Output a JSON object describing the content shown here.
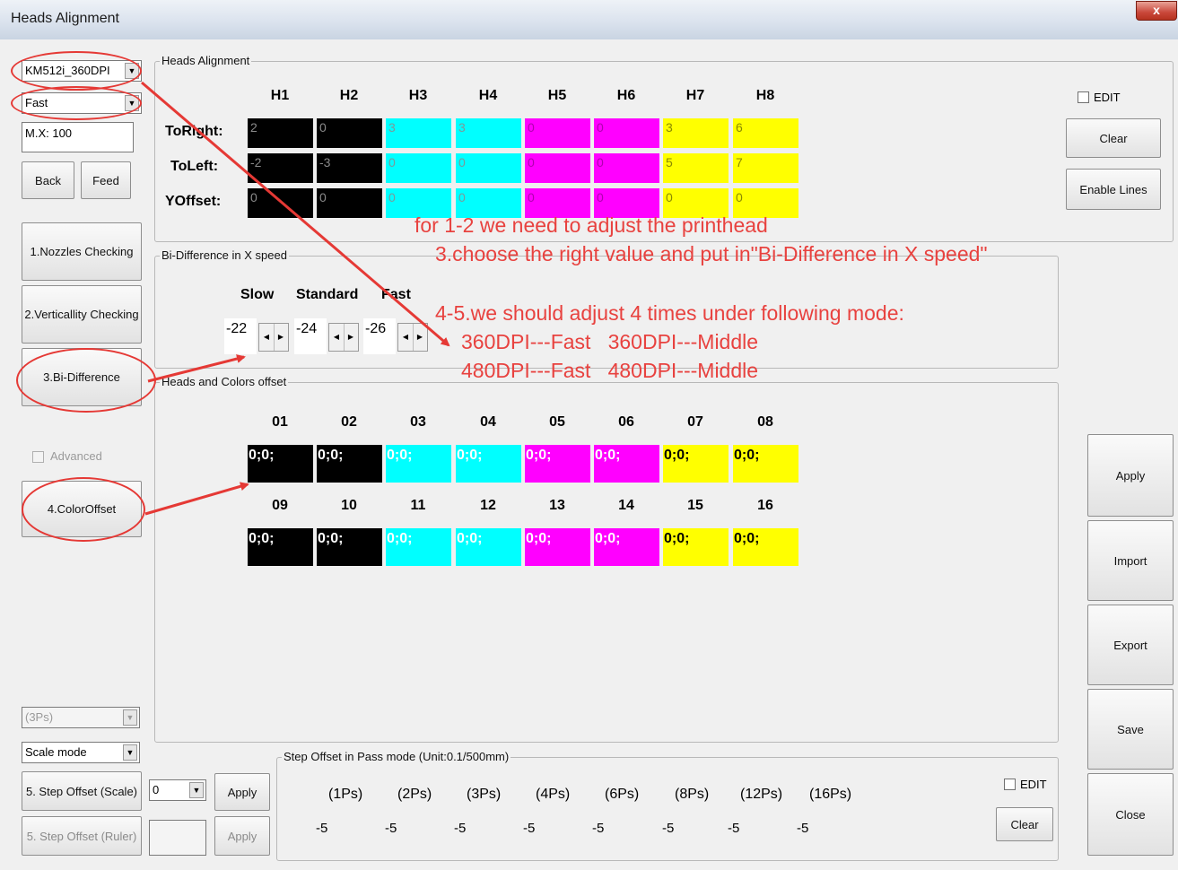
{
  "window": {
    "title": "Heads Alignment",
    "close_label": "x"
  },
  "left": {
    "head_select": "KM512i_360DPI",
    "speed_select": "Fast",
    "mx_value": "M.X: 100",
    "back": "Back",
    "feed": "Feed",
    "nozzles": "1.Nozzles Checking",
    "verticality": "2.Verticallity Checking",
    "bidiff": "3.Bi-Difference",
    "advanced": "Advanced",
    "coloroffset": "4.ColorOffset",
    "pass_select": "(3Ps)",
    "mode_select": "Scale mode",
    "step_scale": "5. Step Offset (Scale)",
    "step_scale_value": "0",
    "apply1": "Apply",
    "step_ruler": "5. Step Offset (Ruler)",
    "apply2": "Apply"
  },
  "heads_alignment": {
    "label": "Heads Alignment",
    "headers": [
      "H1",
      "H2",
      "H3",
      "H4",
      "H5",
      "H6",
      "H7",
      "H8"
    ],
    "colors": [
      "k",
      "k",
      "c",
      "c",
      "m",
      "m",
      "y",
      "y"
    ],
    "rows": [
      {
        "label": "ToRight:",
        "values": [
          "2",
          "0",
          "3",
          "3",
          "0",
          "0",
          "3",
          "6"
        ]
      },
      {
        "label": "ToLeft:",
        "values": [
          "-2",
          "-3",
          "0",
          "0",
          "0",
          "0",
          "5",
          "7"
        ]
      },
      {
        "label": "YOffset:",
        "values": [
          "0",
          "0",
          "0",
          "0",
          "0",
          "0",
          "0",
          "0"
        ]
      }
    ]
  },
  "bi_difference": {
    "label": "Bi-Difference in X speed",
    "slow": "Slow",
    "standard": "Standard",
    "fast": "Fast",
    "slow_value": "-22",
    "standard_value": "-24",
    "fast_value": "-26"
  },
  "colors_offset": {
    "label": "Heads and Colors offset",
    "headers1": [
      "01",
      "02",
      "03",
      "04",
      "05",
      "06",
      "07",
      "08"
    ],
    "headers2": [
      "09",
      "10",
      "11",
      "12",
      "13",
      "14",
      "15",
      "16"
    ],
    "colors": [
      "k",
      "k",
      "c",
      "c",
      "m",
      "m",
      "y",
      "y"
    ],
    "values": "0;0;"
  },
  "step_offset": {
    "label": "Step Offset in Pass mode (Unit:0.1/500mm)",
    "passes": [
      "(1Ps)",
      "(2Ps)",
      "(3Ps)",
      "(4Ps)",
      "(6Ps)",
      "(8Ps)",
      "(12Ps)",
      "(16Ps)"
    ],
    "values": [
      "-5",
      "-5",
      "-5",
      "-5",
      "-5",
      "-5",
      "-5",
      "-5"
    ],
    "edit": "EDIT",
    "clear": "Clear"
  },
  "right": {
    "edit": "EDIT",
    "clear": "Clear",
    "enable_lines": "Enable Lines",
    "apply": "Apply",
    "import": "Import",
    "export": "Export",
    "save": "Save",
    "close": "Close"
  },
  "annotations": {
    "line1": "for 1-2 we need to adjust the printhead",
    "line2": "3.choose the right value and put in\"Bi-Difference in X speed\"",
    "line3": "4-5.we should adjust 4 times under following mode:",
    "line4": "360DPI---Fast   360DPI---Middle",
    "line5": "480DPI---Fast   480DPI---Middle",
    "color": "#e8423f"
  }
}
